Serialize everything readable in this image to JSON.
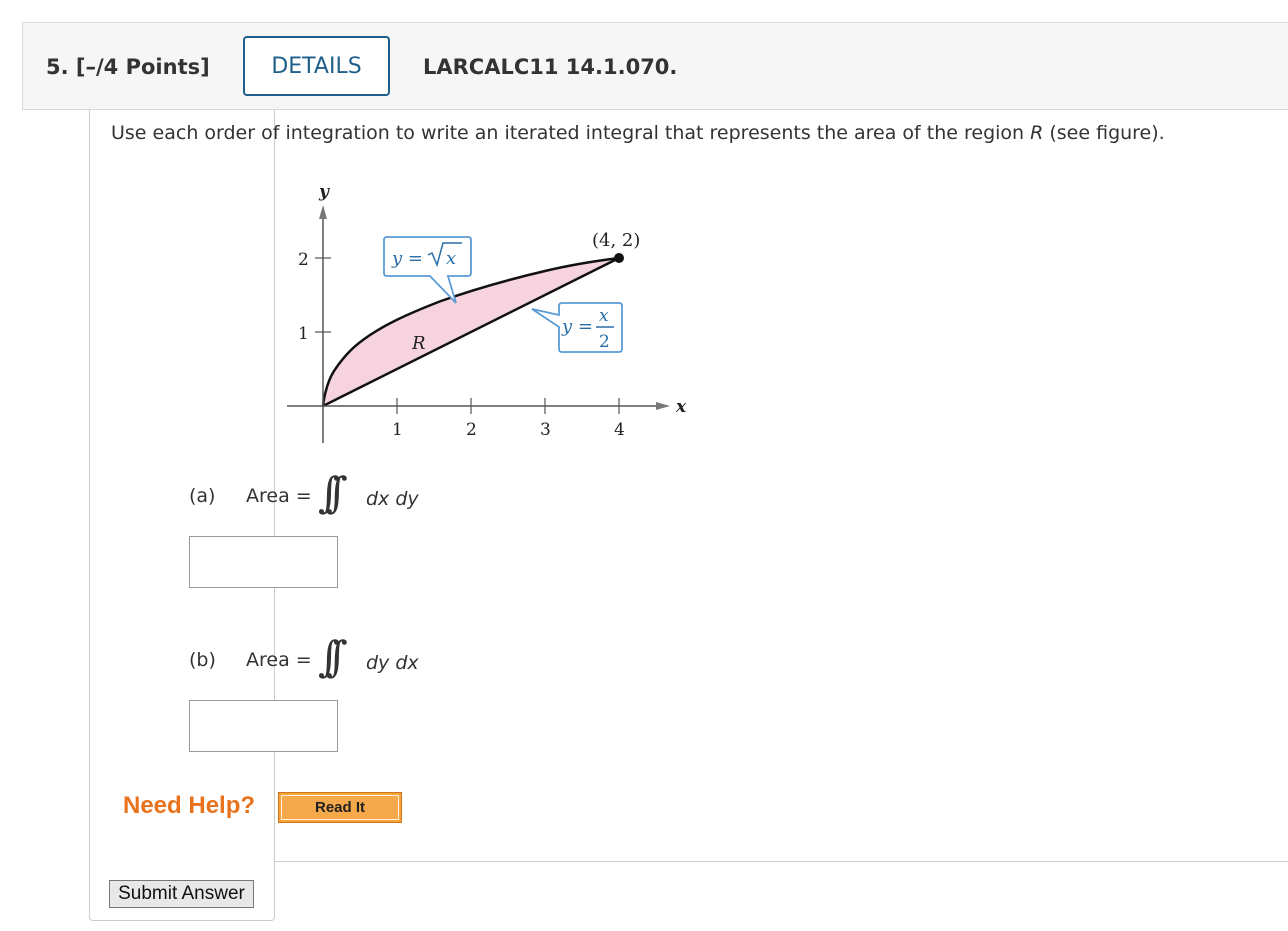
{
  "header": {
    "question_number": "5.",
    "points": "[–/4 Points]",
    "details_label": "DETAILS",
    "problem_code": "LARCALC11 14.1.070."
  },
  "instruction": {
    "before": "Use each order of integration to write an iterated integral that represents the area of the region ",
    "region": "R",
    "after": " (see figure)."
  },
  "figure": {
    "y_axis_label": "y",
    "x_axis_label": "x",
    "y_ticks": [
      "1",
      "2"
    ],
    "x_ticks": [
      "1",
      "2",
      "3",
      "4"
    ],
    "point_label": "(4, 2)",
    "upper_curve_lhs": "y =",
    "upper_curve_radicand": "x",
    "lower_curve_lhs": "y =",
    "lower_curve_numerator": "x",
    "lower_curve_denominator": "2",
    "region_label": "R",
    "region_fill": "#f6d3df"
  },
  "parts": {
    "a": {
      "label": "(a)",
      "area_label": "Area =",
      "integral": "∫∫",
      "differentials": "dx dy",
      "value": ""
    },
    "b": {
      "label": "(b)",
      "area_label": "Area =",
      "integral": "∫∫",
      "differentials": "dy dx",
      "value": ""
    }
  },
  "help": {
    "need_help": "Need Help?",
    "read_it": "Read It"
  },
  "submit": {
    "label": "Submit Answer"
  },
  "colors": {
    "details_border": "#1f5f8a",
    "need_help": "#e8731c",
    "read_it_bg": "#f6a94a"
  }
}
